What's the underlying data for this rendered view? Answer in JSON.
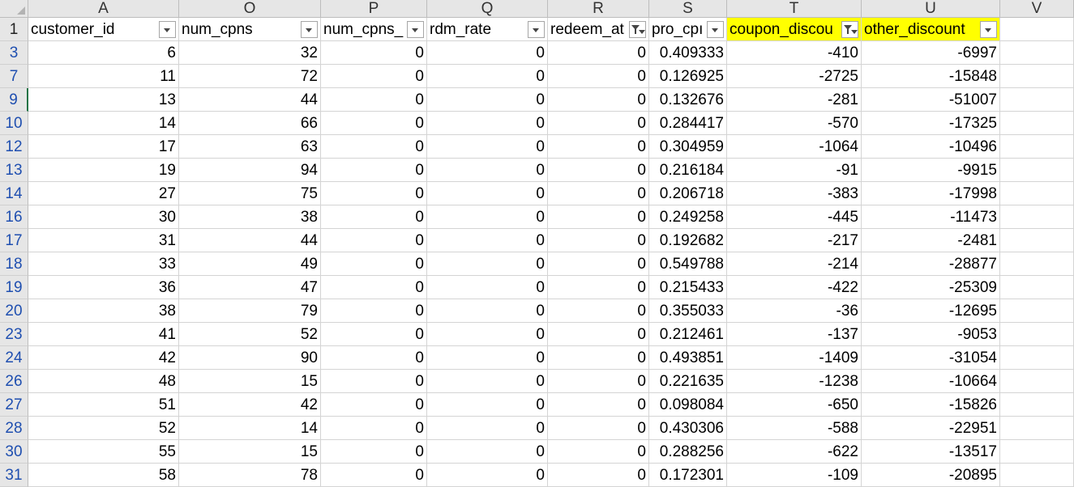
{
  "columns": [
    "A",
    "O",
    "P",
    "Q",
    "R",
    "S",
    "T",
    "U",
    "V"
  ],
  "header_row": "1",
  "headers": [
    "customer_id",
    "num_cpns",
    "num_cpns_",
    "rdm_rate",
    "redeem_at",
    "pro_cpı",
    "coupon_discou",
    "other_discount"
  ],
  "rows": [
    {
      "row": "3",
      "v": [
        "6",
        "32",
        "0",
        "0",
        "0",
        "0.409333",
        "-410",
        "-6997"
      ]
    },
    {
      "row": "7",
      "v": [
        "11",
        "72",
        "0",
        "0",
        "0",
        "0.126925",
        "-2725",
        "-15848"
      ]
    },
    {
      "row": "9",
      "v": [
        "13",
        "44",
        "0",
        "0",
        "0",
        "0.132676",
        "-281",
        "-51007"
      ]
    },
    {
      "row": "10",
      "v": [
        "14",
        "66",
        "0",
        "0",
        "0",
        "0.284417",
        "-570",
        "-17325"
      ]
    },
    {
      "row": "12",
      "v": [
        "17",
        "63",
        "0",
        "0",
        "0",
        "0.304959",
        "-1064",
        "-10496"
      ]
    },
    {
      "row": "13",
      "v": [
        "19",
        "94",
        "0",
        "0",
        "0",
        "0.216184",
        "-91",
        "-9915"
      ]
    },
    {
      "row": "14",
      "v": [
        "27",
        "75",
        "0",
        "0",
        "0",
        "0.206718",
        "-383",
        "-17998"
      ]
    },
    {
      "row": "16",
      "v": [
        "30",
        "38",
        "0",
        "0",
        "0",
        "0.249258",
        "-445",
        "-11473"
      ]
    },
    {
      "row": "17",
      "v": [
        "31",
        "44",
        "0",
        "0",
        "0",
        "0.192682",
        "-217",
        "-2481"
      ]
    },
    {
      "row": "18",
      "v": [
        "33",
        "49",
        "0",
        "0",
        "0",
        "0.549788",
        "-214",
        "-28877"
      ]
    },
    {
      "row": "19",
      "v": [
        "36",
        "47",
        "0",
        "0",
        "0",
        "0.215433",
        "-422",
        "-25309"
      ]
    },
    {
      "row": "20",
      "v": [
        "38",
        "79",
        "0",
        "0",
        "0",
        "0.355033",
        "-36",
        "-12695"
      ]
    },
    {
      "row": "23",
      "v": [
        "41",
        "52",
        "0",
        "0",
        "0",
        "0.212461",
        "-137",
        "-9053"
      ]
    },
    {
      "row": "24",
      "v": [
        "42",
        "90",
        "0",
        "0",
        "0",
        "0.493851",
        "-1409",
        "-31054"
      ]
    },
    {
      "row": "26",
      "v": [
        "48",
        "15",
        "0",
        "0",
        "0",
        "0.221635",
        "-1238",
        "-10664"
      ]
    },
    {
      "row": "27",
      "v": [
        "51",
        "42",
        "0",
        "0",
        "0",
        "0.098084",
        "-650",
        "-15826"
      ]
    },
    {
      "row": "28",
      "v": [
        "52",
        "14",
        "0",
        "0",
        "0",
        "0.430306",
        "-588",
        "-22951"
      ]
    },
    {
      "row": "30",
      "v": [
        "55",
        "15",
        "0",
        "0",
        "0",
        "0.288256",
        "-622",
        "-13517"
      ]
    },
    {
      "row": "31",
      "v": [
        "58",
        "78",
        "0",
        "0",
        "0",
        "0.172301",
        "-109",
        "-20895"
      ]
    }
  ],
  "selected_row": "9",
  "filtered_columns": [
    "R",
    "T"
  ],
  "highlight_columns": [
    "T",
    "U"
  ],
  "colors": {
    "highlight": "#ffff00",
    "header_bg": "#e6e6e6",
    "row_number": "#1f4fb0",
    "selection": "#217346"
  },
  "icons": {
    "filter_button": "dropdown-arrow-icon",
    "active_filter": "funnel-filter-icon"
  }
}
